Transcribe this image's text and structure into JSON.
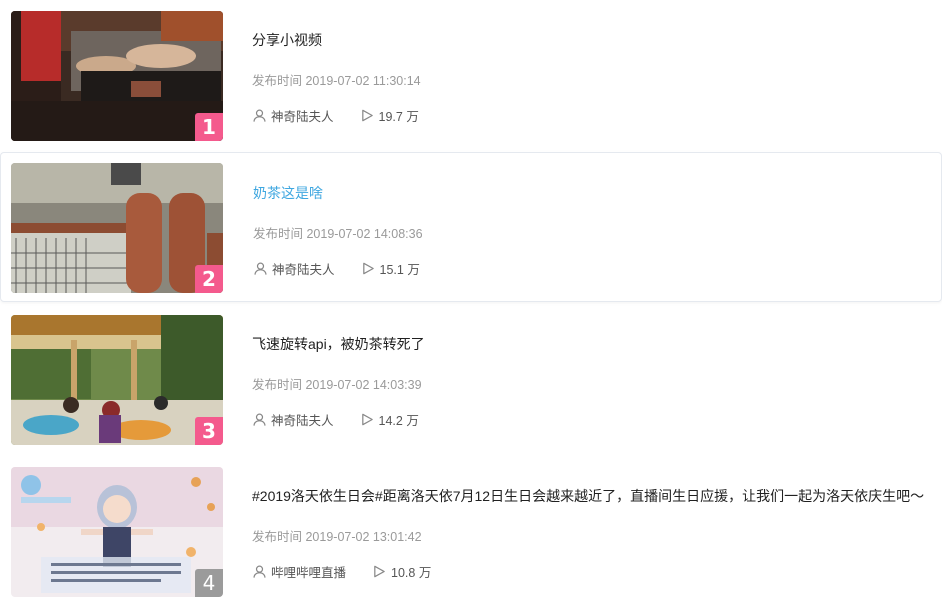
{
  "colors": {
    "rank_top": "#f45a8d",
    "rank_other": "#9b9b9b",
    "title_active": "#3fa7e0",
    "meta_gray": "#9a9a9a"
  },
  "icons": {
    "author": "user-icon",
    "views": "play-count-icon"
  },
  "items": [
    {
      "rank": "1",
      "title": "分享小视频",
      "time": "发布时间 2019-07-02 11:30:14",
      "author": "神奇陆夫人",
      "views": "19.7 万"
    },
    {
      "rank": "2",
      "title": "奶茶这是啥",
      "time": "发布时间 2019-07-02 14:08:36",
      "author": "神奇陆夫人",
      "views": "15.1 万"
    },
    {
      "rank": "3",
      "title": "飞速旋转api，被奶茶转死了",
      "time": "发布时间 2019-07-02 14:03:39",
      "author": "神奇陆夫人",
      "views": "14.2 万"
    },
    {
      "rank": "4",
      "title": "#2019洛天依生日会#距离洛天依7月12日生日会越来越近了，直播间生日应援，让我们一起为洛天依庆生吧～",
      "time": "发布时间 2019-07-02 13:01:42",
      "author": "哔哩哔哩直播",
      "views": "10.8 万"
    }
  ]
}
